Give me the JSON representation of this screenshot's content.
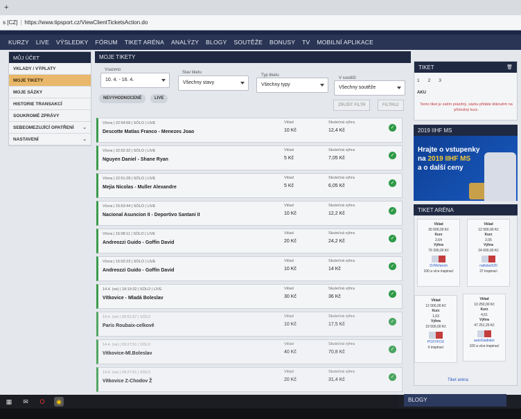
{
  "browser": {
    "tab_plus": "+",
    "url_prefix": "s [CZ]",
    "url": "https://www.tipsport.cz/ViewClientTicketsAction.do"
  },
  "nav": [
    "KURZY",
    "LIVE",
    "VÝSLEDKY",
    "FÓRUM",
    "TIKET ARÉNA",
    "ANALÝZY",
    "BLOGY",
    "SOUTĚŽE",
    "BONUSY",
    "TV",
    "MOBILNÍ APLIKACE"
  ],
  "sidebar": {
    "title": "MŮJ ÚČET",
    "items": [
      {
        "label": "VKLADY / VÝPLATY",
        "chev": ""
      },
      {
        "label": "MOJE TIKETY",
        "chev": ""
      },
      {
        "label": "MOJE SÁZKY",
        "chev": ""
      },
      {
        "label": "HISTORIE TRANSAKCÍ",
        "chev": ""
      },
      {
        "label": "SOUKROMÉ ZPRÁVY",
        "chev": ""
      },
      {
        "label": "SEBEOMEZUJÍCÍ OPATŘENÍ",
        "chev": "⌄"
      },
      {
        "label": "NASTAVENÍ",
        "chev": "⌄"
      }
    ]
  },
  "content": {
    "title": "MOJE TIKETY",
    "filters": {
      "vsazeno": {
        "label": "Vsazeno",
        "value": "10. 4. - 16. 4."
      },
      "stav": {
        "label": "Stav tiketu",
        "value": "Všechny stavy"
      },
      "typ": {
        "label": "Typ tiketu",
        "value": "Všechny typy"
      },
      "soutez": {
        "label": "V soutěži",
        "value": "Všechny soutěže"
      }
    },
    "pills": [
      "NEVYHODNOCENÉ",
      "LIVE"
    ],
    "buttons": {
      "reset": "ZRUŠIT FILTR",
      "filter": "FILTRUJ"
    },
    "tickets": [
      {
        "meta": "Včera | 22:54:58 | SÓLO | LIVE",
        "match": "Descotte Matias Franco - Menezes Joao",
        "vklad_label": "Vklad",
        "vklad": "10 Kč",
        "win_label": "Skutečná výhra",
        "win": "12,4 Kč"
      },
      {
        "meta": "Včera | 22:52:32 | SÓLO | LIVE",
        "match": "Nguyen Daniel - Shane Ryan",
        "vklad_label": "Vklad",
        "vklad": "5 Kč",
        "win_label": "Skutečná výhra",
        "win": "7,05 Kč"
      },
      {
        "meta": "Včera | 22:51:28 | SÓLO | LIVE",
        "match": "Mejia Nicolas - Muller Alexandre",
        "vklad_label": "Vklad",
        "vklad": "5 Kč",
        "win_label": "Skutečná výhra",
        "win": "6,05 Kč"
      },
      {
        "meta": "Včera | 15:53:44 | SÓLO | LIVE",
        "match": "Nacional Asuncion II - Deportivo Santani II",
        "vklad_label": "Vklad",
        "vklad": "10 Kč",
        "win_label": "Skutečná výhra",
        "win": "12,2 Kč"
      },
      {
        "meta": "Včera | 15:08:11 | SÓLO | LIVE",
        "match": "Andreozzi Guido - Goffin David",
        "vklad_label": "Vklad",
        "vklad": "20 Kč",
        "win_label": "Skutečná výhra",
        "win": "24,2 Kč"
      },
      {
        "meta": "Včera | 15:02:23 | SÓLO | LIVE",
        "match": "Andreozzi Guido - Goffin David",
        "vklad_label": "Vklad",
        "vklad": "10 Kč",
        "win_label": "Skutečná výhra",
        "win": "14 Kč"
      },
      {
        "meta": "14.4. (ne) | 18:19:32 | SÓLO | LIVE",
        "match": "Vítkovice - Mladá Boleslav",
        "vklad_label": "Vklad",
        "vklad": "30 Kč",
        "win_label": "Skutečná výhra",
        "win": "36 Kč"
      },
      {
        "meta": "14.4. (ne) | 09:51:57 | SÓLO",
        "match": "Paris Roubaix-celkově",
        "vklad_label": "Vklad",
        "vklad": "10 Kč",
        "win_label": "Skutečná výhra",
        "win": "17,5 Kč"
      },
      {
        "meta": "14.4. (ne) | 09:27:51 | SÓLO",
        "match": "Vitkovice-Ml.Boleslav",
        "vklad_label": "Vklad",
        "vklad": "40 Kč",
        "win_label": "Skutečná výhra",
        "win": "70,8 Kč"
      },
      {
        "meta": "14.4. (ne) | 09:27:51 | SÓLO",
        "match": "Vitkovice Z-Chodov Ž",
        "vklad_label": "Vklad",
        "vklad": "20 Kč",
        "win_label": "Skutečná výhra",
        "win": "31,4 Kč"
      }
    ]
  },
  "tiket": {
    "title": "TIKET",
    "tabs": [
      "1",
      "2",
      "3"
    ],
    "aku": "AKU",
    "empty": "Tento tiket je zatím prázdný, sázku přidáte kliknutím na příslušný kurz."
  },
  "ms": {
    "title": "2019 IIHF MS",
    "line1": "Hrajte o vstupenky",
    "line2a": "na ",
    "line2b": "2019 IIHF MS",
    "line3": "a o další ceny"
  },
  "arena": {
    "title": "TIKET ARÉNA",
    "link": "Tiket aréna",
    "cards": [
      {
        "l1": "Vklad",
        "v1": "30 000,00 Kč",
        "l2": "Kurz",
        "v2": "2,64",
        "l3": "Výhra",
        "v3": "79 200,00 Kč",
        "user": "SVMcfarem",
        "note": "100 a více inspirací"
      },
      {
        "l1": "Vklad",
        "v1": "12 000,00 Kč",
        "l2": "Kurz",
        "v2": "2,05",
        "l3": "Výhra",
        "v3": "24 600,00 Kč",
        "user": "radislav520",
        "note": "37 inspirací"
      },
      {
        "l1": "Vklad",
        "v1": "12 000,00 Kč",
        "l2": "Kurz",
        "v2": "1,63",
        "l3": "Výhra",
        "v3": "19 500,00 Kč",
        "user": "POXYFOX",
        "note": "0 inspirací"
      },
      {
        "l1": "Vklad",
        "v1": "10 250,00 Kč",
        "l2": "Kurz",
        "v2": "4,61",
        "l3": "Výhra",
        "v3": "47 251,25 Kč",
        "user": "autoGladiator",
        "note": "100 a více inspirací"
      }
    ]
  },
  "blogy": "BLOGY"
}
